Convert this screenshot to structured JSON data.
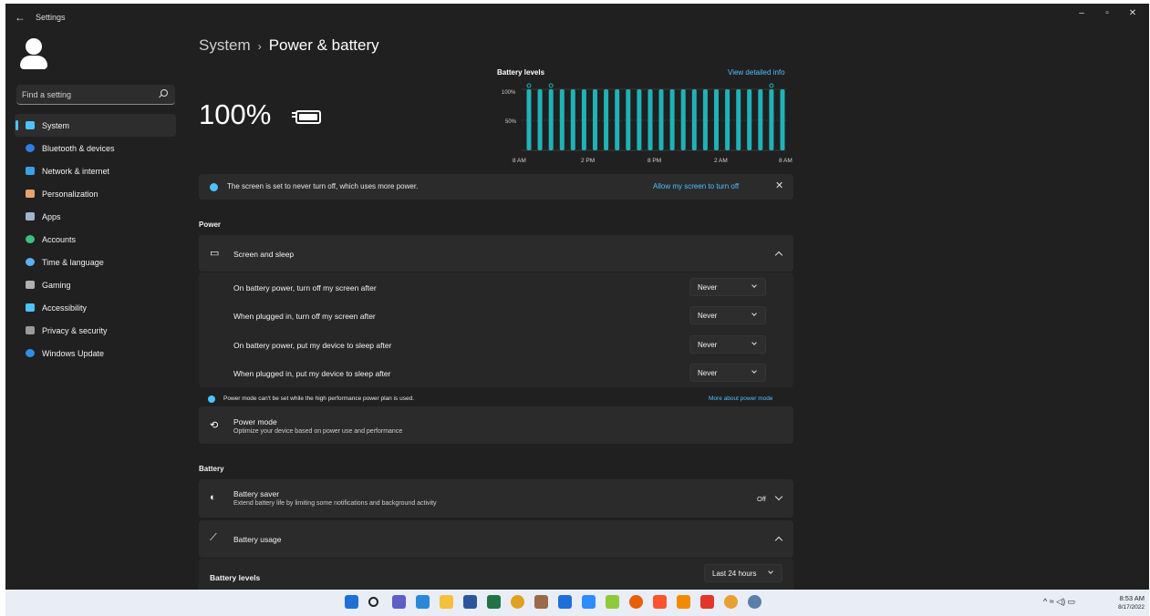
{
  "window": {
    "back_glyph": "←",
    "title": "Settings",
    "controls": {
      "minimize": "–",
      "maximize": "▫",
      "close": "✕"
    }
  },
  "sidebar": {
    "search_placeholder": "Find a setting",
    "items": [
      {
        "label": "System",
        "icon": "system-icon",
        "color": "#4cc2ff",
        "active": true
      },
      {
        "label": "Bluetooth & devices",
        "icon": "bluetooth-icon",
        "color": "#2f7fe0"
      },
      {
        "label": "Network & internet",
        "icon": "wifi-icon",
        "color": "#3aa0e8"
      },
      {
        "label": "Personalization",
        "icon": "brush-icon",
        "color": "#e8a36a"
      },
      {
        "label": "Apps",
        "icon": "apps-icon",
        "color": "#a0b4d0"
      },
      {
        "label": "Accounts",
        "icon": "person-icon",
        "color": "#3fbf7f"
      },
      {
        "label": "Time & language",
        "icon": "globe-icon",
        "color": "#5ab0f0"
      },
      {
        "label": "Gaming",
        "icon": "gamepad-icon",
        "color": "#b0b0b0"
      },
      {
        "label": "Accessibility",
        "icon": "accessibility-icon",
        "color": "#4cc2ff"
      },
      {
        "label": "Privacy & security",
        "icon": "shield-icon",
        "color": "#9a9a9a"
      },
      {
        "label": "Windows Update",
        "icon": "update-icon",
        "color": "#2f8fe8"
      }
    ]
  },
  "header": {
    "breadcrumb_parent": "System",
    "breadcrumb_sep": "›",
    "page_title": "Power & battery",
    "battery_percent": "100%"
  },
  "top_chart": {
    "title": "Battery levels",
    "link": "View detailed info",
    "y_ticks": [
      "100%",
      "50%"
    ],
    "x_ticks": [
      "8 AM",
      "2 PM",
      "8 PM",
      "2 AM",
      "8 AM"
    ]
  },
  "chart_data": {
    "type": "bar",
    "title": "Battery levels",
    "xlabel": "",
    "ylabel": "",
    "ylim": [
      0,
      100
    ],
    "y_unit": "%",
    "x_tick_labels": [
      "8 AM",
      "2 PM",
      "8 PM",
      "2 AM",
      "8 AM"
    ],
    "values": [
      100,
      100,
      100,
      100,
      100,
      100,
      100,
      100,
      100,
      100,
      100,
      100,
      100,
      100,
      100,
      100,
      100,
      100,
      100,
      100,
      100,
      100,
      100,
      100
    ],
    "charging_marker_bars": [
      0,
      2,
      22
    ],
    "bar_color": "#1fb3b8",
    "grid": true
  },
  "notice": {
    "text": "The screen is set to never turn off, which uses more power.",
    "link": "Allow my screen to turn off",
    "close": "✕"
  },
  "power": {
    "section_label": "Power",
    "screen_sleep": {
      "title": "Screen and sleep",
      "rows": [
        {
          "label": "On battery power, turn off my screen after",
          "value": "Never"
        },
        {
          "label": "When plugged in, turn off my screen after",
          "value": "Never"
        },
        {
          "label": "On battery power, put my device to sleep after",
          "value": "Never"
        },
        {
          "label": "When plugged in, put my device to sleep after",
          "value": "Never"
        }
      ]
    },
    "mode_note": {
      "text": "Power mode can't be set while the high performance power plan is used.",
      "link": "More about power mode"
    },
    "power_mode": {
      "title": "Power mode",
      "desc": "Optimize your device based on power use and performance"
    }
  },
  "battery": {
    "section_label": "Battery",
    "saver": {
      "title": "Battery saver",
      "desc": "Extend battery life by limiting some notifications and background activity",
      "state": "Off"
    },
    "usage": {
      "title": "Battery usage"
    },
    "levels": {
      "label": "Battery levels",
      "range": "Last 24 hours"
    }
  },
  "taskbar": {
    "apps": [
      {
        "name": "start-icon",
        "color": "#1f6fd6"
      },
      {
        "name": "search-icon",
        "color": "#222222"
      },
      {
        "name": "chat-icon",
        "color": "#5b5fc7"
      },
      {
        "name": "widgets-icon",
        "color": "#2b88d8"
      },
      {
        "name": "file-explorer-icon",
        "color": "#f3c13a"
      },
      {
        "name": "word-icon",
        "color": "#2b579a"
      },
      {
        "name": "excel-icon",
        "color": "#217346"
      },
      {
        "name": "chrome-icon",
        "color": "#e0a020"
      },
      {
        "name": "app-icon",
        "color": "#9a6a4a"
      },
      {
        "name": "teamviewer-icon",
        "color": "#1e6fd9"
      },
      {
        "name": "zoom-icon",
        "color": "#2d8cff"
      },
      {
        "name": "android-icon",
        "color": "#8fc93a"
      },
      {
        "name": "firefox-icon",
        "color": "#e66000"
      },
      {
        "name": "brave-icon",
        "color": "#fb542b"
      },
      {
        "name": "vlc-icon",
        "color": "#f28a00"
      },
      {
        "name": "anydesk-icon",
        "color": "#e2362b"
      },
      {
        "name": "chrome-canary-icon",
        "color": "#e8a030"
      },
      {
        "name": "settings-icon",
        "color": "#5a7fa8"
      }
    ],
    "tray": "^  ≈  ◁)  ▭",
    "time": "8:53 AM",
    "date": "8/17/2022"
  }
}
